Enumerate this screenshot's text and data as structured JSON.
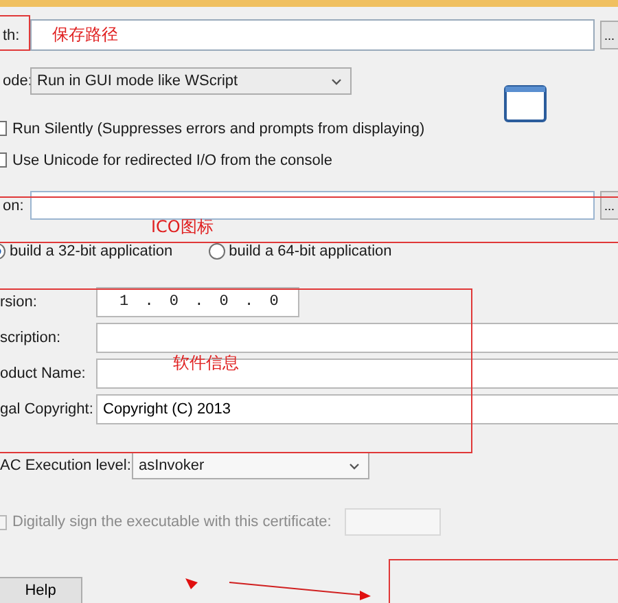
{
  "path": {
    "label": "th:",
    "browse": "..."
  },
  "mode": {
    "label": "ode:",
    "value": "Run in GUI mode like WScript"
  },
  "options": [
    {
      "label": "Run Silently (Suppresses errors and prompts from displaying)",
      "checked": false
    },
    {
      "label": "Use Unicode for redirected I/O from the console",
      "checked": false
    }
  ],
  "icon": {
    "label": "on:",
    "browse": "..."
  },
  "architecture": [
    {
      "label": "build a 32-bit application",
      "selected": true
    },
    {
      "label": "build a 64-bit application",
      "selected": false
    }
  ],
  "info": [
    {
      "label": "rsion:",
      "kind": "version",
      "value": "1 . 0 . 0 . 0"
    },
    {
      "label": "scription:",
      "kind": "text"
    },
    {
      "label": "oduct Name:",
      "kind": "text"
    },
    {
      "label": "gal Copyright:",
      "kind": "text",
      "value": "Copyright (C) 2013"
    }
  ],
  "uac": {
    "label": "AC Execution level:",
    "value": "asInvoker"
  },
  "sign": {
    "label": "Digitally sign the executable with this certificate:",
    "checked": false,
    "disabled": true
  },
  "help_button": "Help",
  "notes": [
    "保存路径",
    "ICO图标",
    "软件信息"
  ]
}
